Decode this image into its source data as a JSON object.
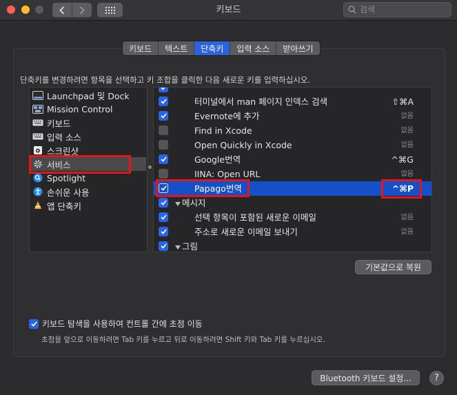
{
  "window": {
    "title": "키보드"
  },
  "search": {
    "placeholder": "검색"
  },
  "tabs": [
    {
      "label": "키보드"
    },
    {
      "label": "텍스트"
    },
    {
      "label": "단축키",
      "active": true
    },
    {
      "label": "입력 소스"
    },
    {
      "label": "받아쓰기"
    }
  ],
  "instruction": "단축키를 변경하려면 항목을 선택하고 키 조합을 클릭한 다음 새로운 키를 입력하십시오.",
  "categories": [
    {
      "label": "Launchpad 및 Dock",
      "icon": "launchpad-icon"
    },
    {
      "label": "Mission Control",
      "icon": "mission-control-icon"
    },
    {
      "label": "키보드",
      "icon": "keyboard-icon"
    },
    {
      "label": "입력 소스",
      "icon": "input-source-icon"
    },
    {
      "label": "스크린샷",
      "icon": "screenshot-icon"
    },
    {
      "label": "서비스",
      "icon": "gear-icon",
      "selected": true
    },
    {
      "label": "Spotlight",
      "icon": "spotlight-icon"
    },
    {
      "label": "손쉬운 사용",
      "icon": "accessibility-icon"
    },
    {
      "label": "앱 단축키",
      "icon": "app-shortcuts-icon"
    }
  ],
  "shortcuts": [
    {
      "label": "",
      "key": "",
      "checked": true,
      "type": "item"
    },
    {
      "label": "터미널에서 man 페이지 인덱스 검색",
      "key": "⇧⌘A",
      "checked": true,
      "type": "item"
    },
    {
      "label": "Evernote에 추가",
      "key": "없음",
      "checked": true,
      "type": "item"
    },
    {
      "label": "Find in Xcode",
      "key": "없음",
      "checked": false,
      "type": "item"
    },
    {
      "label": "Open Quickly in Xcode",
      "key": "없음",
      "checked": false,
      "type": "item"
    },
    {
      "label": "Google번역",
      "key": "^⌘G",
      "checked": true,
      "type": "item"
    },
    {
      "label": "IINA: Open URL",
      "key": "없음",
      "checked": false,
      "type": "item"
    },
    {
      "label": "Papago번역",
      "key": "^⌘P",
      "checked": true,
      "type": "item",
      "selected": true
    },
    {
      "label": "메시지",
      "key": "",
      "checked": true,
      "type": "group"
    },
    {
      "label": "선택 항목이 포함된 새로운 이메일",
      "key": "없음",
      "checked": true,
      "type": "item"
    },
    {
      "label": "주소로 새로운 이메일 보내기",
      "key": "없음",
      "checked": true,
      "type": "item"
    },
    {
      "label": "그림",
      "key": "",
      "checked": true,
      "type": "group"
    }
  ],
  "restore_button": "기본값으로 복원",
  "keyboard_nav": {
    "label": "키보드 탐색을 사용하여 컨트롤 간에 초점 이동",
    "checked": true,
    "description": "초점을 앞으로 이동하려면 Tab 키를 누르고 뒤로 이동하려면 Shift 키와 Tab 키를 누르십시오."
  },
  "bluetooth_button": "Bluetooth 키보드 설정...",
  "help_button": "?",
  "colors": {
    "accent": "#2a64e4",
    "selection": "#1550c8",
    "highlight": "#e6141b"
  }
}
